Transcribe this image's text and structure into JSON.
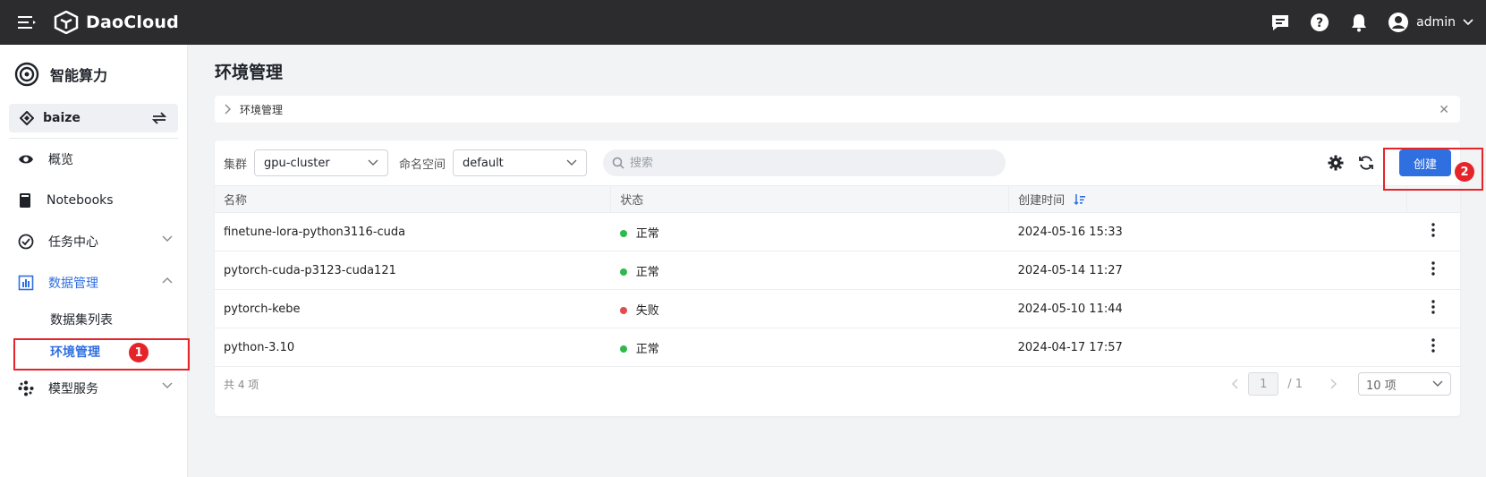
{
  "topbar": {
    "brand": "DaoCloud",
    "user": "admin"
  },
  "sidebar": {
    "module_title": "智能算力",
    "workspace": "baize",
    "items": [
      {
        "label": "概览"
      },
      {
        "label": "Notebooks"
      },
      {
        "label": "任务中心"
      },
      {
        "label": "数据管理"
      },
      {
        "label": "模型服务"
      }
    ],
    "sub_items": [
      {
        "label": "数据集列表"
      },
      {
        "label": "环境管理"
      }
    ]
  },
  "main": {
    "title": "环境管理",
    "breadcrumb": "环境管理",
    "filters": {
      "cluster_label": "集群",
      "cluster_value": "gpu-cluster",
      "namespace_label": "命名空间",
      "namespace_value": "default",
      "search_placeholder": "搜索"
    },
    "create_label": "创建",
    "columns": [
      "名称",
      "状态",
      "创建时间"
    ],
    "rows": [
      {
        "name": "finetune-lora-python3116-cuda",
        "status": "正常",
        "status_color": "#2fb84d",
        "created": "2024-05-16 15:33"
      },
      {
        "name": "pytorch-cuda-p3123-cuda121",
        "status": "正常",
        "status_color": "#2fb84d",
        "created": "2024-05-14 11:27"
      },
      {
        "name": "pytorch-kebe",
        "status": "失败",
        "status_color": "#e5484d",
        "created": "2024-05-10 11:44"
      },
      {
        "name": "python-3.10",
        "status": "正常",
        "status_color": "#2fb84d",
        "created": "2024-04-17 17:57"
      }
    ],
    "total": "共 4 项",
    "pagination": {
      "current": "1",
      "of_total": "/ 1",
      "page_size": "10 项"
    }
  },
  "annotations": [
    "1",
    "2"
  ],
  "colors": {
    "accent": "#2f6fe0",
    "topbar": "#2c2c2e",
    "annotation": "#e5242a"
  }
}
